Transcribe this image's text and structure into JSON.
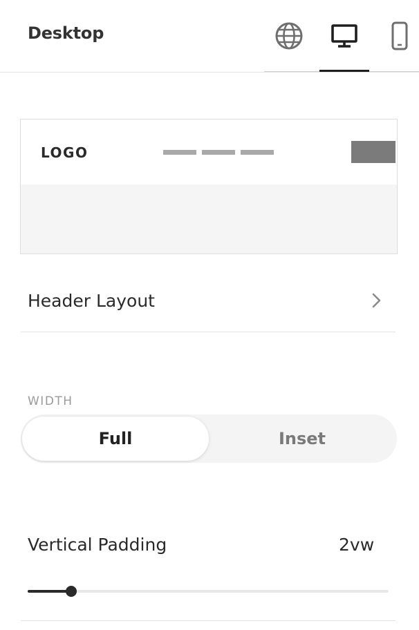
{
  "header": {
    "title": "Desktop",
    "tabs": [
      {
        "icon": "globe-icon",
        "selected": false
      },
      {
        "icon": "desktop-monitor-icon",
        "selected": true
      },
      {
        "icon": "mobile-phone-icon",
        "selected": false
      }
    ]
  },
  "preview": {
    "logo_text": "LOGO"
  },
  "header_layout": {
    "label": "Header Layout",
    "icon": "chevron-right-icon"
  },
  "width": {
    "section_label": "WIDTH",
    "options": [
      "Full",
      "Inset"
    ],
    "selected": "Full"
  },
  "vertical_padding": {
    "label": "Vertical Padding",
    "value": "2vw",
    "slider_fraction": 0.12
  },
  "colors": {
    "accent": "#1f1f1f",
    "muted_text": "#9a9a9a",
    "preview_nav": "#a9a9a9",
    "preview_button": "#7b7b7b"
  }
}
